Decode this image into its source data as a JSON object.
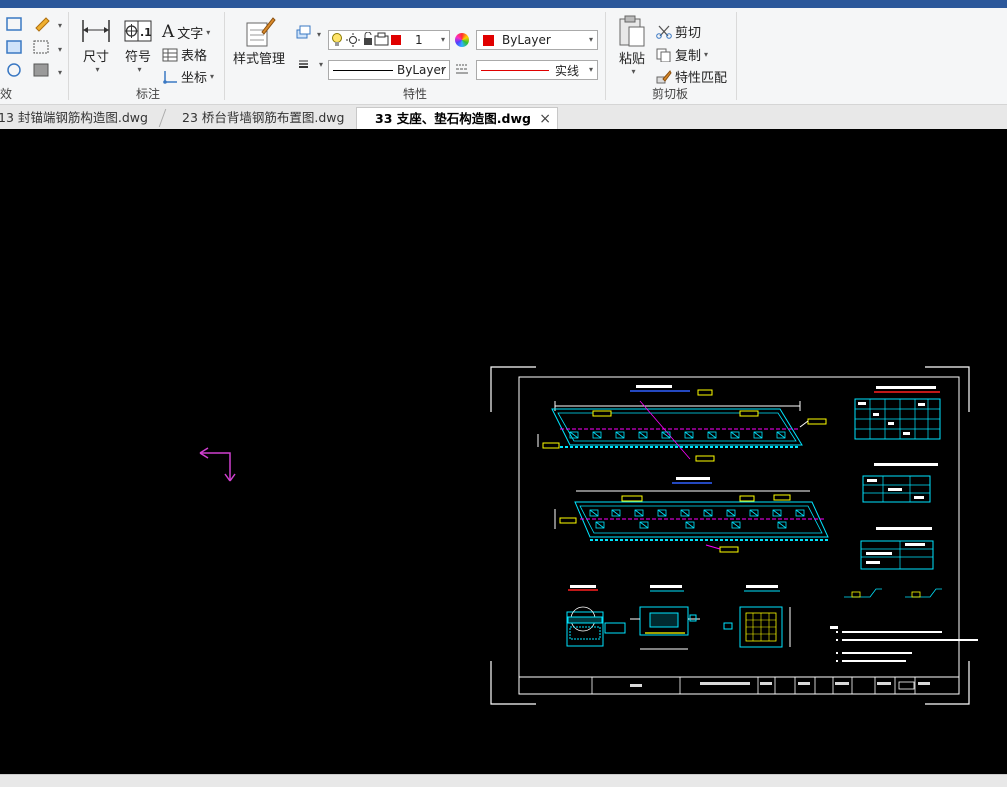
{
  "ribbon": {
    "groups": {
      "partial_left": "效",
      "annotation": "标注",
      "properties": "特性",
      "clipboard": "剪切板"
    },
    "annotation": {
      "dimension": "尺寸",
      "symbol": "符号",
      "text": "文字",
      "table": "表格",
      "coordinate": "坐标"
    },
    "style_manager": "样式管理",
    "properties": {
      "layer_value": "1",
      "color_value": "ByLayer",
      "linetype_value": "ByLayer",
      "lineweight_value": "实线",
      "color_swatch": "#e00000"
    },
    "clipboard": {
      "paste": "粘贴",
      "cut": "剪切",
      "copy": "复制",
      "match_properties": "特性匹配"
    }
  },
  "tabs": [
    {
      "label": "13 封锚端钢筋构造图.dwg",
      "active": false
    },
    {
      "label": "23 桥台背墙钢筋布置图.dwg",
      "active": false
    },
    {
      "label": "33 支座、垫石构造图.dwg",
      "active": true
    }
  ],
  "tab_close": "×",
  "colors": {
    "drawing_border": "#ffffff",
    "cyan": "#00e5ff",
    "yellow": "#ffff00",
    "magenta": "#ff00ff",
    "red": "#ff2020",
    "ucs": "#d040d0"
  }
}
